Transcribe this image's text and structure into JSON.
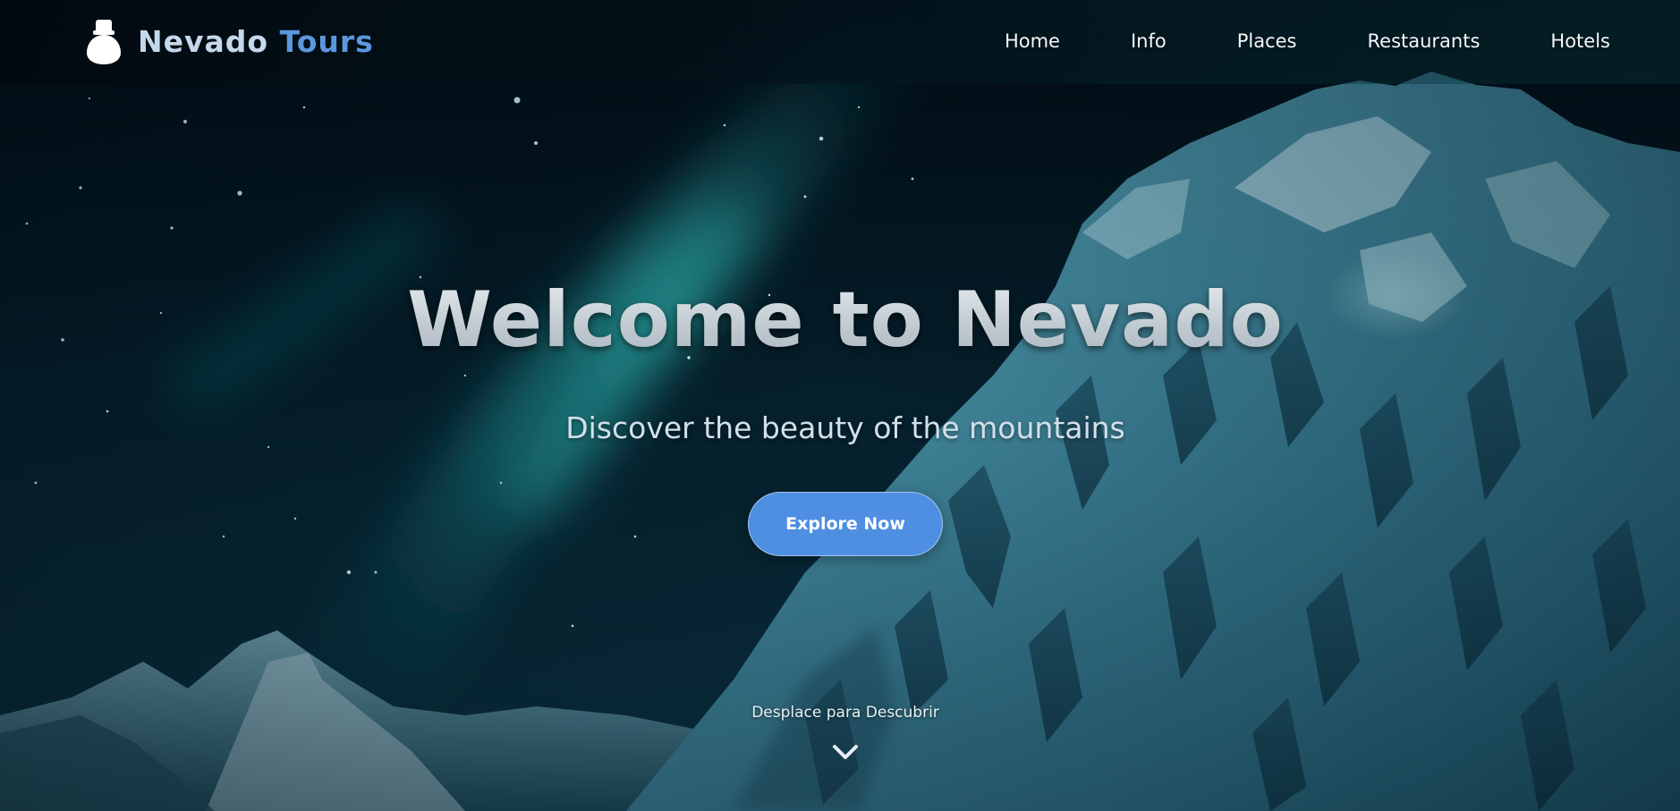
{
  "brand": {
    "icon": "snow-mountain-hat-icon",
    "name_primary": "Nevado",
    "name_accent": "Tours",
    "accent_color": "#5b97dd"
  },
  "nav": {
    "items": [
      {
        "label": "Home"
      },
      {
        "label": "Info"
      },
      {
        "label": "Places"
      },
      {
        "label": "Restaurants"
      },
      {
        "label": "Hotels"
      }
    ]
  },
  "hero": {
    "title": "Welcome to Nevado",
    "subtitle": "Discover the beauty of the mountains",
    "cta_label": "Explore Now",
    "cta_color": "#4f8fe2",
    "scroll_hint": "Desplace para Descubrir",
    "scroll_icon": "chevron-down-icon"
  }
}
